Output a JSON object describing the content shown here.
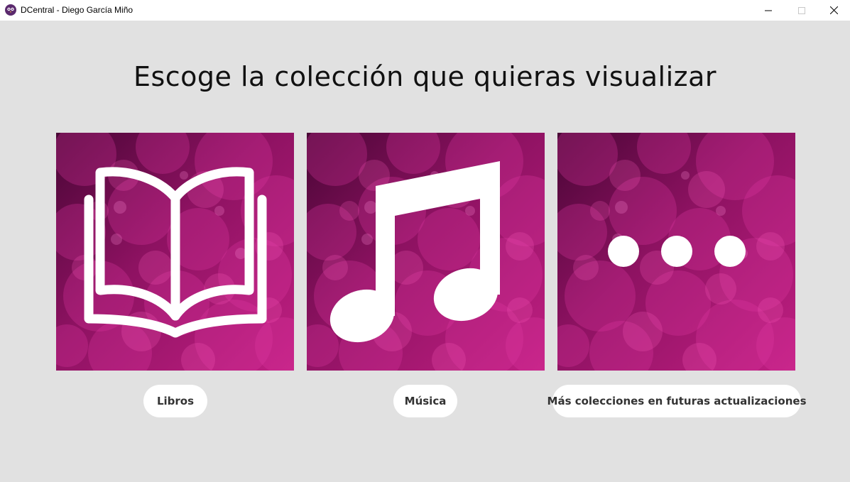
{
  "window": {
    "title": "DCentral - Diego García Miño",
    "app_icon": "owl-icon"
  },
  "heading": "Escoge la colección que quieras visualizar",
  "colors": {
    "tile_dark": "#5a0a3e",
    "tile_mid": "#a0156e",
    "tile_bright": "#e0309a",
    "glyph": "#ffffff",
    "background": "#e1e1e1",
    "pill_bg": "#ffffff"
  },
  "collections": [
    {
      "icon": "book-open-icon",
      "label": "Libros"
    },
    {
      "icon": "music-note-icon",
      "label": "Música"
    },
    {
      "icon": "more-dots-icon",
      "label": "Más colecciones en futuras actualizaciones"
    }
  ]
}
